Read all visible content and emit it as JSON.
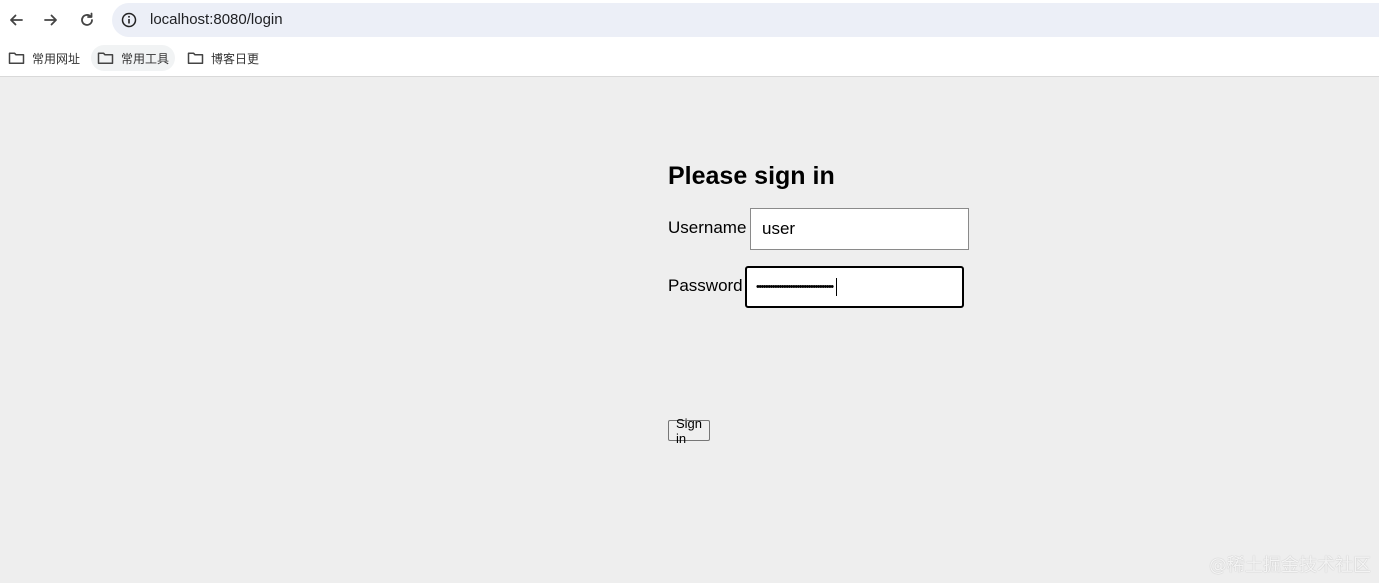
{
  "browser": {
    "url": "localhost:8080/login",
    "bookmarks": [
      {
        "label": "常用网址",
        "icon": "folder-icon"
      },
      {
        "label": "常用工具",
        "icon": "folder-icon"
      },
      {
        "label": "博客日更",
        "icon": "folder-icon"
      }
    ]
  },
  "login": {
    "title": "Please sign in",
    "username_label": "Username",
    "username_value": "user",
    "password_label": "Password",
    "password_masked": "••••••••••••••••••••••••••••••••••",
    "submit_label": "Sign in"
  },
  "watermark": "@稀土掘金技术社区",
  "colors": {
    "page_bg": "#eeeeee",
    "omnibox_bg": "#eceff7"
  }
}
